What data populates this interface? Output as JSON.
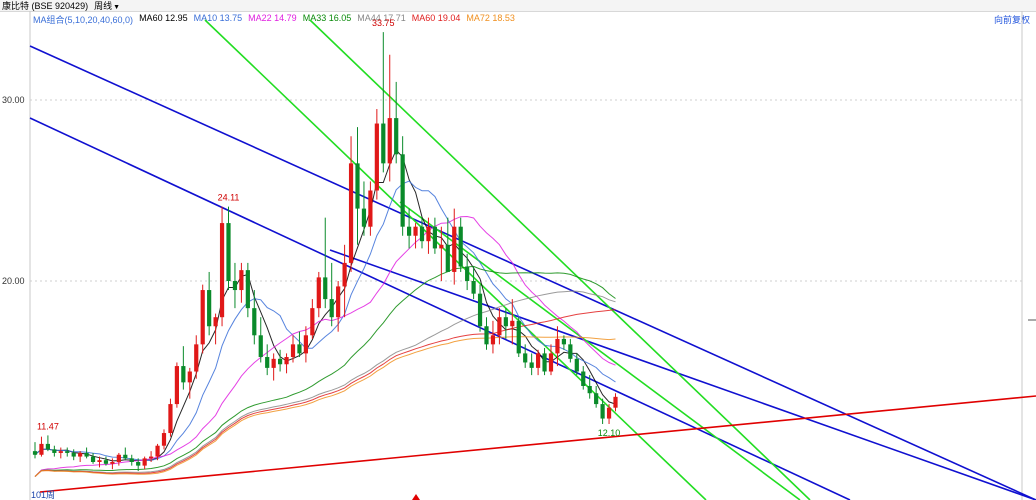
{
  "header": {
    "stock_label": "康比特",
    "stock_code": "(BSE 920429)",
    "period": "周线",
    "adjust_label": "向前复权"
  },
  "legend": {
    "combo": "MA组合(5,10,20,40,60,0)",
    "items": [
      {
        "text": "MA60 12.95",
        "color": "#000000"
      },
      {
        "text": "MA10 13.75",
        "color": "#3a6fd8"
      },
      {
        "text": "MA22 14.79",
        "color": "#e020e0"
      },
      {
        "text": "MA33 16.05",
        "color": "#0a8a0a"
      },
      {
        "text": "MA44 17.71",
        "color": "#888888"
      },
      {
        "text": "MA60 19.04",
        "color": "#e02020"
      },
      {
        "text": "MA72 18.53",
        "color": "#f09020"
      }
    ]
  },
  "chart_data": {
    "type": "candlestick",
    "y_ticks": [
      "30.00",
      "20.00"
    ],
    "grid": true,
    "annotations": [
      {
        "text": "33.75",
        "value": 33.75,
        "color": "#d00000"
      },
      {
        "text": "24.11",
        "value": 24.11,
        "color": "#d00000"
      },
      {
        "text": "11.47",
        "value": 11.47,
        "color": "#d00000"
      },
      {
        "text": "12.10",
        "value": 12.1,
        "color": "#0a8a0a"
      }
    ],
    "bottom_left_label": "101周",
    "candles": [
      [
        10.6,
        11.1,
        10.2,
        10.4
      ],
      [
        10.4,
        11.4,
        10.3,
        11.0
      ],
      [
        11.0,
        11.47,
        10.6,
        10.7
      ],
      [
        10.7,
        10.9,
        10.3,
        10.5
      ],
      [
        10.5,
        10.8,
        10.2,
        10.6
      ],
      [
        10.6,
        10.8,
        10.3,
        10.5
      ],
      [
        10.5,
        10.7,
        10.1,
        10.3
      ],
      [
        10.3,
        10.6,
        10.0,
        10.5
      ],
      [
        10.5,
        10.8,
        10.2,
        10.3
      ],
      [
        10.3,
        10.5,
        9.9,
        10.0
      ],
      [
        10.0,
        10.3,
        9.7,
        10.1
      ],
      [
        10.1,
        10.3,
        9.8,
        9.9
      ],
      [
        9.9,
        10.2,
        9.6,
        10.0
      ],
      [
        10.0,
        10.5,
        9.8,
        10.4
      ],
      [
        10.4,
        10.8,
        10.1,
        10.2
      ],
      [
        10.2,
        10.4,
        9.8,
        10.0
      ],
      [
        10.0,
        10.2,
        9.5,
        9.8
      ],
      [
        9.8,
        10.3,
        9.6,
        10.2
      ],
      [
        10.2,
        10.6,
        10.0,
        10.3
      ],
      [
        10.3,
        11.0,
        10.1,
        10.9
      ],
      [
        10.9,
        11.8,
        10.7,
        11.6
      ],
      [
        11.6,
        13.5,
        11.4,
        13.2
      ],
      [
        13.2,
        15.5,
        13.0,
        15.3
      ],
      [
        15.3,
        16.4,
        14.0,
        14.4
      ],
      [
        14.4,
        15.2,
        13.5,
        15.0
      ],
      [
        15.0,
        17.0,
        14.6,
        16.5
      ],
      [
        16.5,
        19.8,
        16.0,
        19.5
      ],
      [
        19.5,
        20.5,
        17.0,
        17.5
      ],
      [
        17.5,
        18.2,
        16.5,
        18.0
      ],
      [
        18.0,
        24.11,
        17.5,
        23.2
      ],
      [
        23.2,
        24.11,
        19.5,
        20.0
      ],
      [
        20.0,
        21.0,
        18.5,
        19.5
      ],
      [
        19.5,
        21.0,
        18.8,
        20.6
      ],
      [
        20.6,
        21.0,
        18.0,
        18.5
      ],
      [
        18.5,
        19.5,
        16.5,
        17.0
      ],
      [
        17.0,
        18.0,
        15.5,
        15.8
      ],
      [
        15.8,
        16.5,
        14.8,
        15.2
      ],
      [
        15.2,
        16.0,
        14.5,
        15.7
      ],
      [
        15.7,
        16.2,
        15.0,
        15.4
      ],
      [
        15.4,
        16.0,
        14.9,
        15.8
      ],
      [
        15.8,
        17.0,
        15.5,
        16.5
      ],
      [
        16.5,
        17.2,
        15.8,
        16.0
      ],
      [
        16.0,
        17.5,
        15.5,
        17.0
      ],
      [
        17.0,
        19.0,
        16.8,
        18.5
      ],
      [
        18.5,
        20.5,
        18.0,
        20.2
      ],
      [
        20.2,
        23.5,
        18.5,
        19.0
      ],
      [
        19.0,
        21.0,
        17.5,
        18.0
      ],
      [
        18.0,
        20.0,
        17.2,
        19.7
      ],
      [
        19.7,
        22.0,
        18.0,
        21.0
      ],
      [
        21.0,
        28.0,
        20.5,
        26.5
      ],
      [
        26.5,
        28.5,
        22.0,
        24.0
      ],
      [
        24.0,
        25.5,
        22.5,
        23.0
      ],
      [
        23.0,
        25.5,
        22.5,
        25.0
      ],
      [
        25.0,
        29.5,
        24.5,
        28.7
      ],
      [
        28.7,
        33.75,
        26.0,
        26.5
      ],
      [
        26.5,
        32.5,
        25.5,
        29.0
      ],
      [
        29.0,
        31.0,
        26.5,
        27.0
      ],
      [
        27.0,
        28.0,
        22.5,
        23.0
      ],
      [
        23.0,
        24.0,
        21.8,
        22.5
      ],
      [
        22.5,
        23.2,
        21.8,
        23.0
      ],
      [
        23.0,
        23.5,
        21.8,
        22.2
      ],
      [
        22.2,
        23.5,
        21.5,
        23.0
      ],
      [
        23.0,
        23.5,
        21.5,
        21.8
      ],
      [
        21.8,
        23.0,
        20.0,
        22.0
      ],
      [
        22.0,
        23.5,
        21.0,
        20.5
      ],
      [
        20.5,
        24.0,
        19.8,
        23.0
      ],
      [
        23.0,
        23.5,
        20.5,
        20.8
      ],
      [
        20.8,
        21.5,
        19.5,
        20.0
      ],
      [
        20.0,
        20.8,
        19.0,
        19.3
      ],
      [
        19.3,
        19.8,
        17.2,
        17.5
      ],
      [
        17.5,
        18.0,
        16.2,
        16.5
      ],
      [
        16.5,
        17.8,
        16.0,
        17.0
      ],
      [
        17.0,
        18.5,
        16.5,
        18.0
      ],
      [
        18.0,
        18.5,
        16.8,
        17.5
      ],
      [
        17.5,
        19.0,
        16.5,
        17.8
      ],
      [
        17.8,
        18.0,
        15.8,
        16.0
      ],
      [
        16.0,
        16.5,
        15.2,
        15.5
      ],
      [
        15.5,
        16.0,
        14.8,
        15.2
      ],
      [
        15.2,
        16.2,
        14.8,
        16.0
      ],
      [
        16.0,
        16.3,
        14.8,
        15.0
      ],
      [
        15.0,
        16.5,
        14.8,
        16.0
      ],
      [
        16.0,
        17.5,
        15.3,
        16.8
      ],
      [
        16.8,
        17.0,
        16.2,
        16.5
      ],
      [
        16.5,
        16.8,
        15.5,
        15.7
      ],
      [
        15.7,
        16.0,
        14.8,
        15.0
      ],
      [
        15.0,
        15.3,
        14.0,
        14.2
      ],
      [
        14.2,
        14.8,
        13.5,
        13.8
      ],
      [
        13.8,
        14.2,
        13.0,
        13.2
      ],
      [
        13.2,
        13.5,
        12.1,
        12.4
      ],
      [
        12.4,
        13.2,
        12.1,
        13.0
      ],
      [
        13.0,
        13.8,
        12.8,
        13.6
      ]
    ]
  }
}
